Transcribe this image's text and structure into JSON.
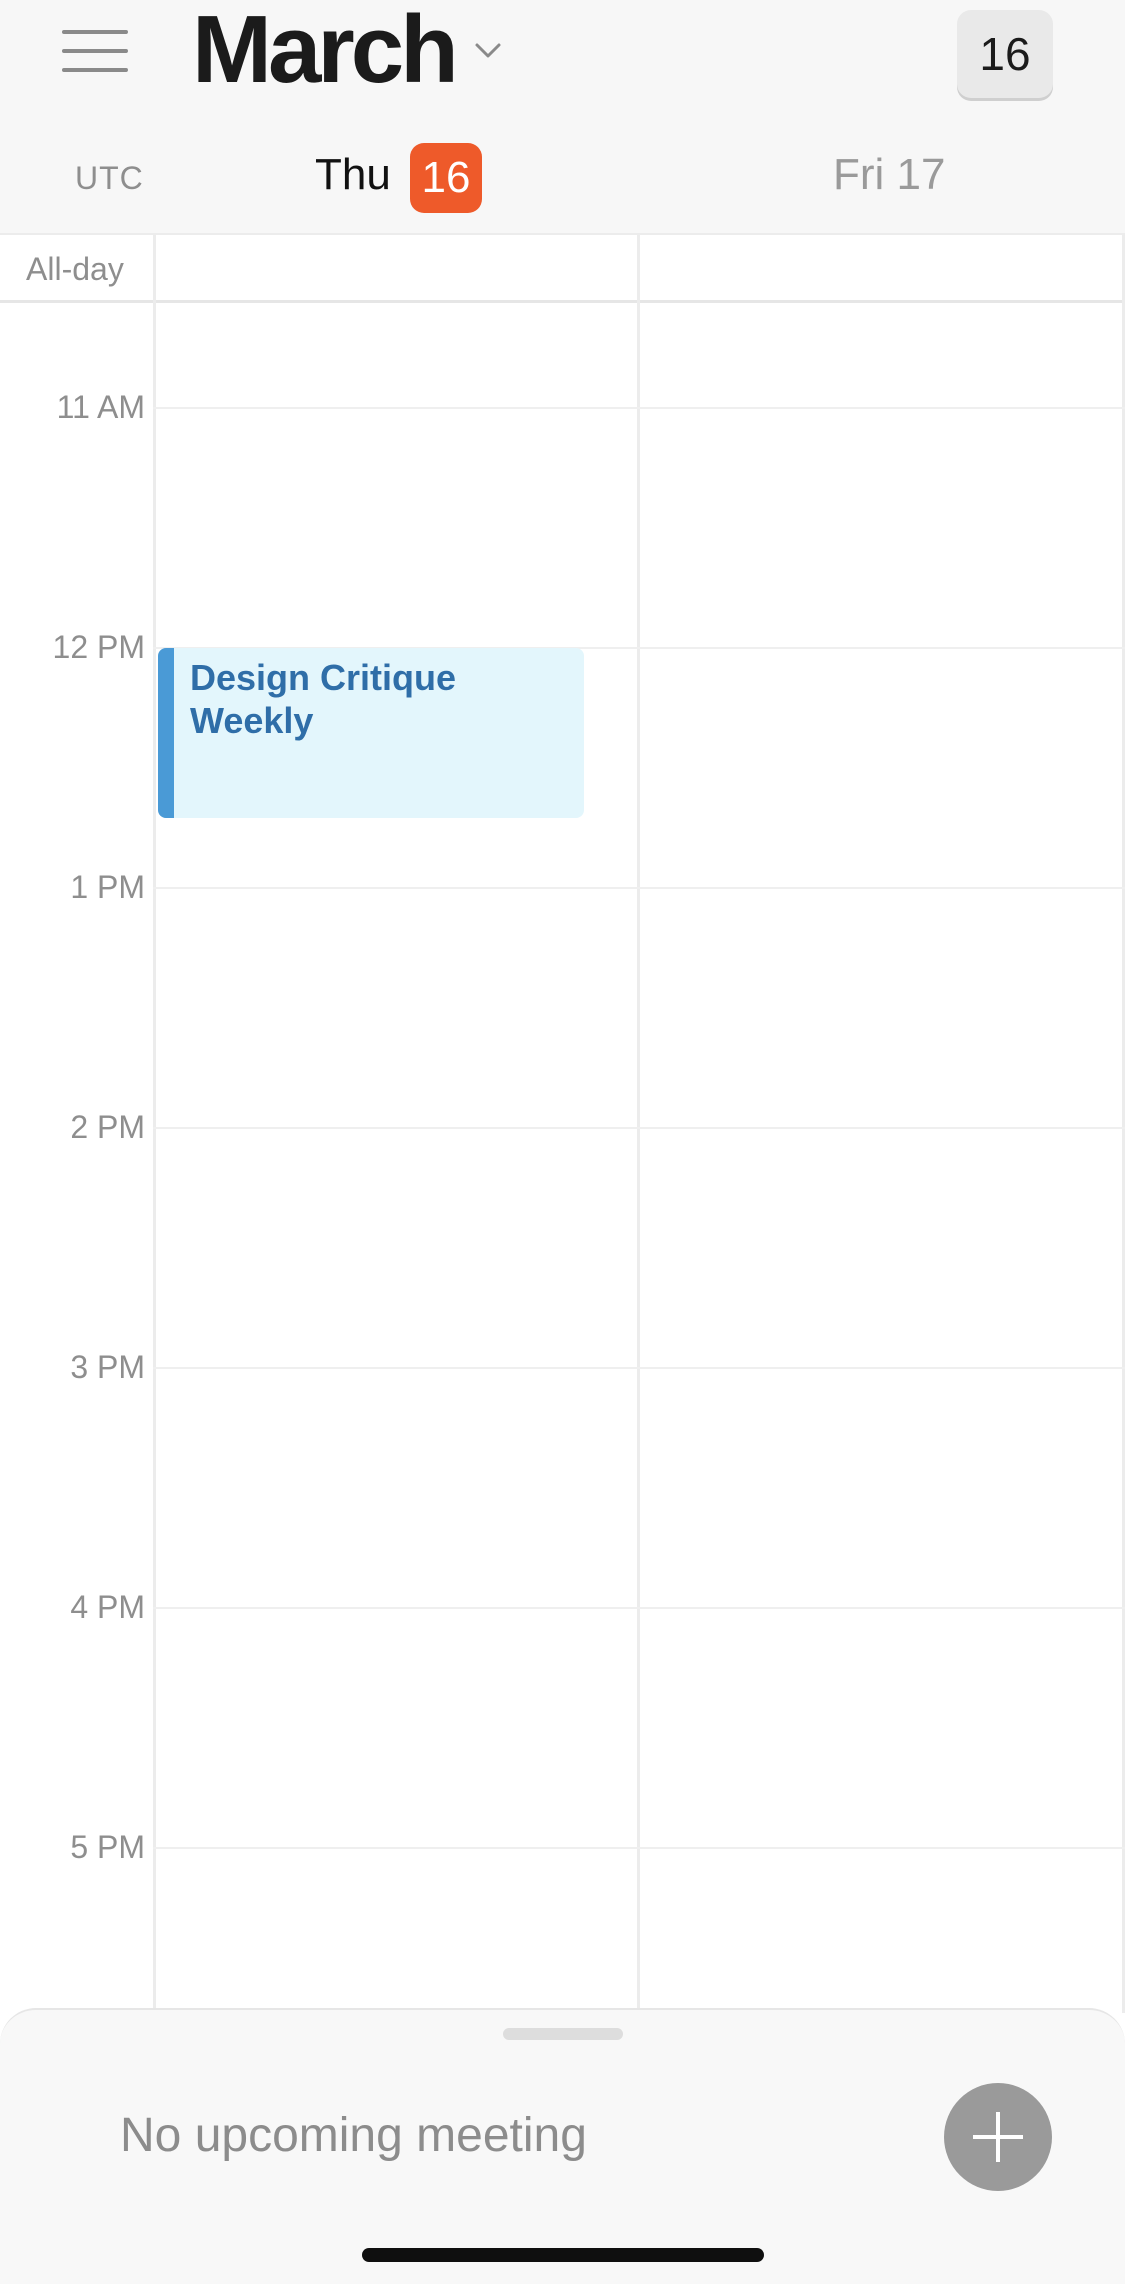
{
  "header": {
    "menu_icon": "hamburger-menu-icon",
    "month": "March",
    "month_dropdown_icon": "chevron-down-icon",
    "today_button": "16"
  },
  "columns": {
    "timezone": "UTC",
    "day1": {
      "name": "Thu",
      "date": "16",
      "is_today": true
    },
    "day2": {
      "label": "Fri 17"
    }
  },
  "allday": {
    "label": "All-day"
  },
  "hours": [
    "11 AM",
    "12 PM",
    "1 PM",
    "2 PM",
    "3 PM",
    "4 PM",
    "5 PM"
  ],
  "events": [
    {
      "title": "Design Critique Weekly",
      "day": "Thu 16",
      "start": "12 PM"
    }
  ],
  "bottom_sheet": {
    "status": "No upcoming meeting",
    "add_icon": "plus-icon"
  },
  "colors": {
    "today_badge": "#ee5a2a",
    "event_bg": "#e3f6fc",
    "event_accent": "#4a9ad6",
    "event_text": "#2f6ea8"
  }
}
